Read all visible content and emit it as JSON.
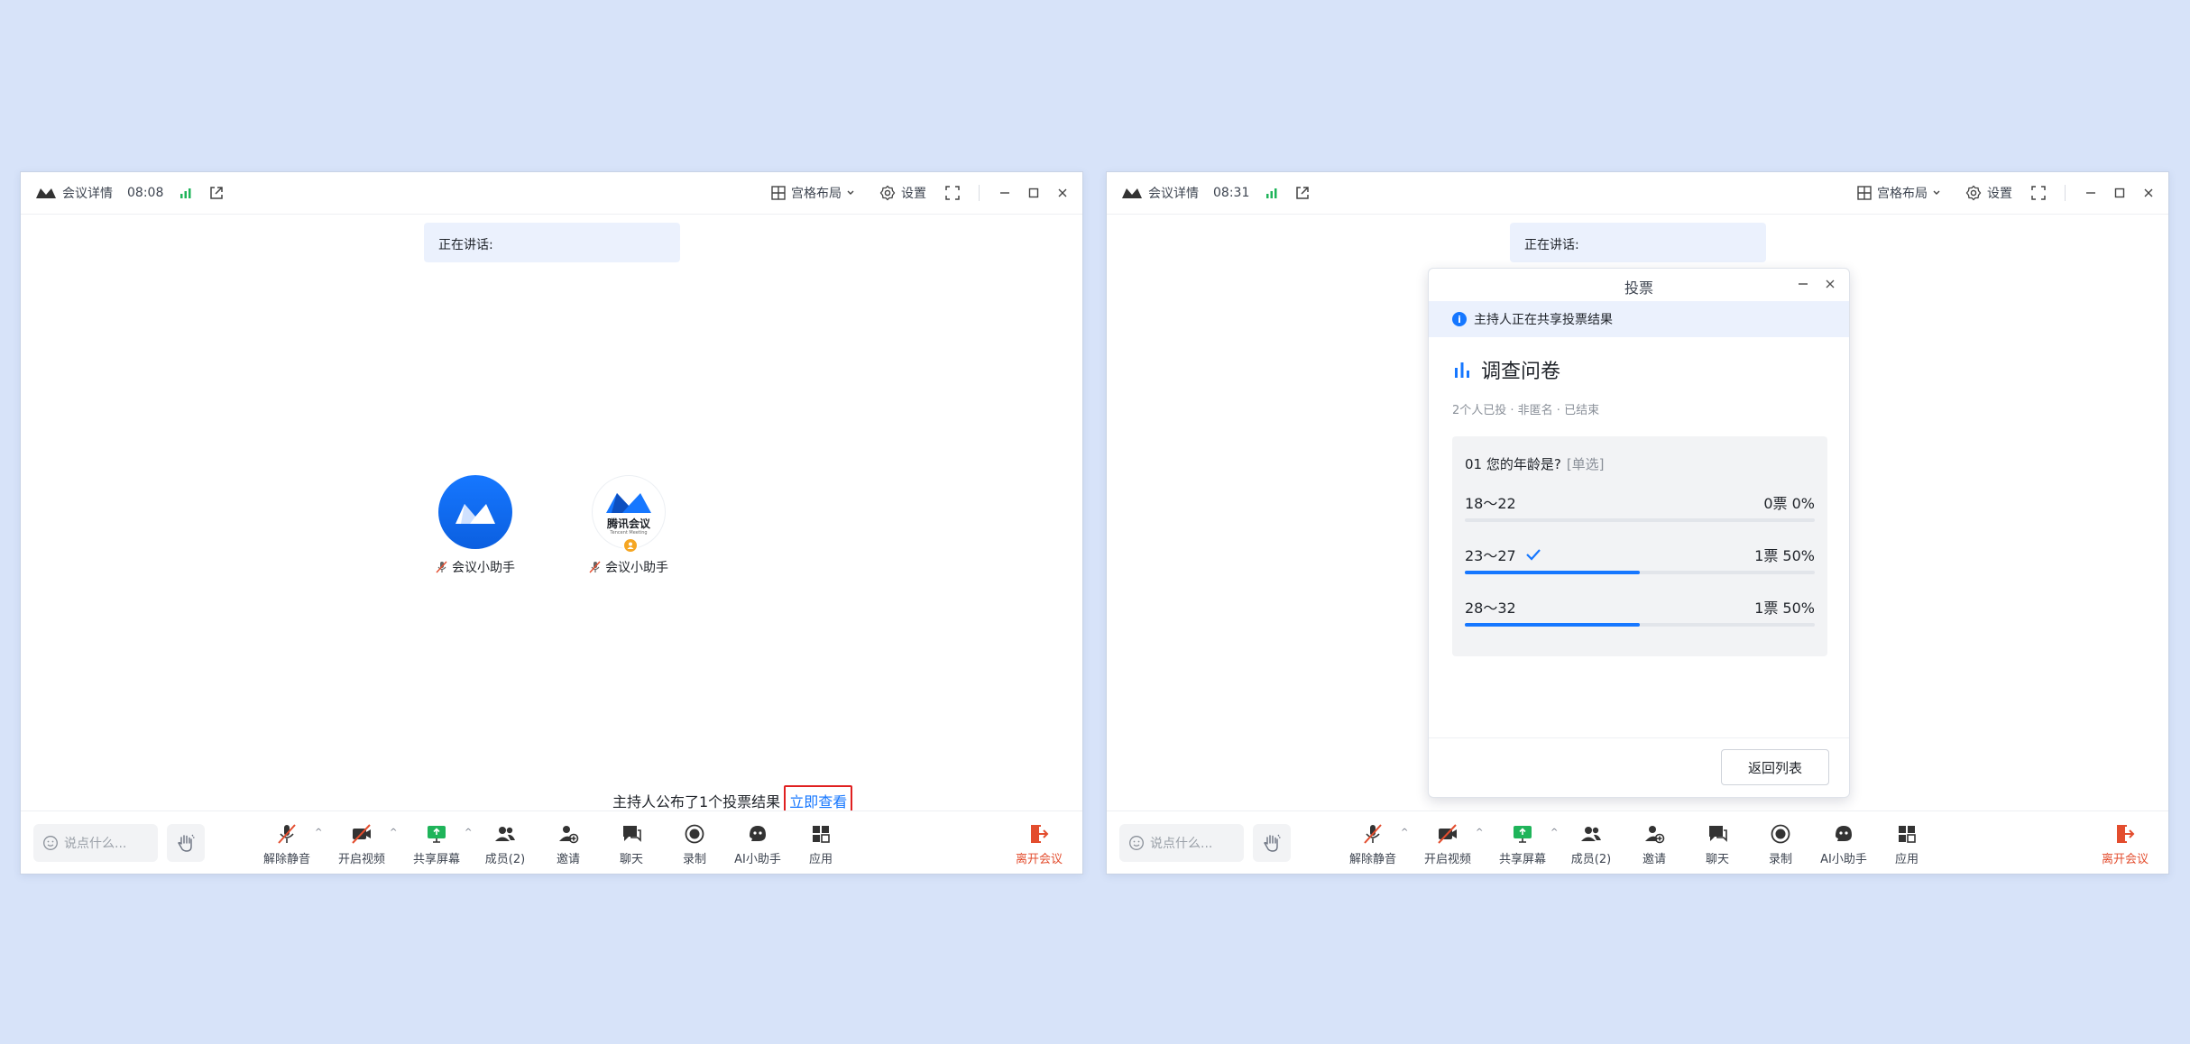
{
  "colors": {
    "background": "#d7e3f9",
    "accent": "#1677ff",
    "signal": "#1fb45a",
    "leave": "#e34d2e",
    "highlight_border": "#e02020"
  },
  "windows": [
    {
      "titlebar": {
        "meeting_details": "会议详情",
        "time": "08:08",
        "layout_label": "宫格布局",
        "settings_label": "设置"
      },
      "speaking_label": "正在讲话:",
      "participants": [
        {
          "name": "会议小助手",
          "avatar": "meeting-logo-blue"
        },
        {
          "name": "会议小助手",
          "avatar": "tencent-meeting-logo",
          "logo_text": "腾讯会议",
          "logo_subtext": "Tencent Meeting"
        }
      ],
      "notification": {
        "text": "主持人公布了1个投票结果",
        "link": "立即查看"
      }
    },
    {
      "titlebar": {
        "meeting_details": "会议详情",
        "time": "08:31",
        "layout_label": "宫格布局",
        "settings_label": "设置"
      },
      "speaking_label": "正在讲话:",
      "poll": {
        "header": "投票",
        "notice": "主持人正在共享投票结果",
        "title": "调查问卷",
        "meta": "2个人已投 · 非匿名 · 已结束",
        "question": {
          "label": "01  您的年龄是?",
          "type": "[单选]",
          "options": [
            {
              "label": "18～22",
              "result": "0票 0%",
              "percent": 0,
              "selected": false
            },
            {
              "label": "23～27",
              "result": "1票 50%",
              "percent": 50,
              "selected": true
            },
            {
              "label": "28～32",
              "result": "1票 50%",
              "percent": 50,
              "selected": false
            }
          ]
        },
        "back_button": "返回列表"
      }
    }
  ],
  "toolbar": {
    "chat_placeholder": "说点什么...",
    "mute": "解除静音",
    "video": "开启视频",
    "share": "共享屏幕",
    "members": "成员(2)",
    "invite": "邀请",
    "chat": "聊天",
    "record": "录制",
    "ai": "AI小助手",
    "apps": "应用",
    "leave": "离开会议"
  }
}
